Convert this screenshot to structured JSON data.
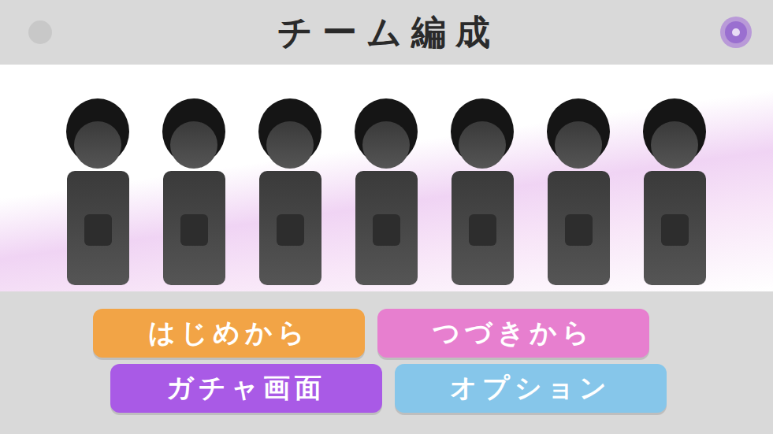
{
  "header": {
    "title": "チーム編成"
  },
  "characters": [
    {
      "locked": true
    },
    {
      "locked": true
    },
    {
      "locked": true
    },
    {
      "locked": true
    },
    {
      "locked": true
    },
    {
      "locked": true
    },
    {
      "locked": true
    }
  ],
  "buttons": [
    {
      "label": "はじめから",
      "color": "#f2a446"
    },
    {
      "label": "つづきから",
      "color": "#e77fcf"
    },
    {
      "label": "ガチャ画面",
      "color": "#a95ae6"
    },
    {
      "label": "オプション",
      "color": "#86c6ea"
    }
  ]
}
